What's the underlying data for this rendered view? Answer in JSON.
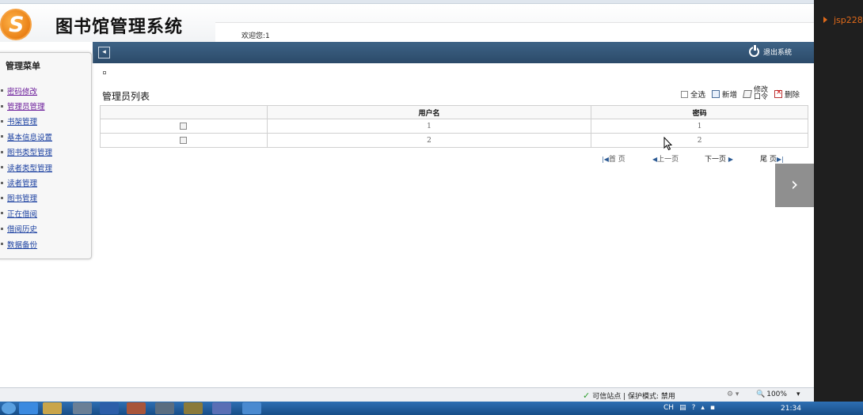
{
  "header": {
    "app_title": "图书馆管理系统",
    "logo_glyph": "S",
    "welcome": "欢迎您:1"
  },
  "navbar": {
    "logout_label": "退出系统"
  },
  "sidebar": {
    "title": "管理菜单",
    "items": [
      {
        "label": "密码修改"
      },
      {
        "label": "管理员管理"
      },
      {
        "label": "书架管理"
      },
      {
        "label": "基本信息设置"
      },
      {
        "label": "图书类型管理"
      },
      {
        "label": "读者类型管理"
      },
      {
        "label": "读者管理"
      },
      {
        "label": "图书管理"
      },
      {
        "label": "正在借阅"
      },
      {
        "label": "借阅历史"
      },
      {
        "label": "数据备份"
      }
    ]
  },
  "main": {
    "list_title": "管理员列表",
    "toolbar": {
      "select_all": "全选",
      "add": "新增",
      "edit_line1": "修改",
      "edit_line2": "口令",
      "delete": "删除"
    },
    "table": {
      "columns": [
        "",
        "用户名",
        "密码"
      ],
      "rows": [
        {
          "username": "1",
          "password": "1"
        },
        {
          "username": "2",
          "password": "2"
        }
      ]
    },
    "pager": {
      "first": "首 页",
      "prev": "上一页",
      "next": "下一页",
      "last": "尾 页"
    }
  },
  "statusbar": {
    "trusted": "可信站点 | 保护模式: 禁用",
    "zoom": "100%"
  },
  "taskbar": {
    "ime": "CH",
    "clock": "21:34"
  },
  "right_panel": {
    "label": "jsp228"
  },
  "colors": {
    "navbar": "#2f5070",
    "link": "#1a3fa0",
    "accent": "#e06a1a"
  }
}
